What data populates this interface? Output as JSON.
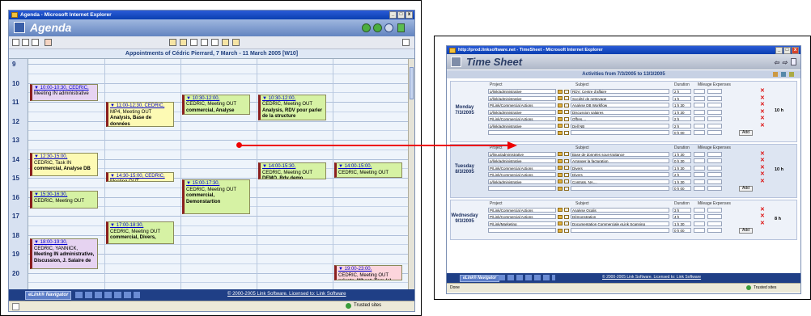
{
  "agenda": {
    "window_title": "Agenda - Microsoft Internet Explorer",
    "app_title": "Agenda",
    "calendar_header": "Appointments of Cédric Pierrard, 7 March - 11 March 2005 [W10]",
    "hours": [
      "9",
      "10",
      "11",
      "12",
      "13",
      "14",
      "15",
      "16",
      "17",
      "18",
      "19",
      "20"
    ],
    "events": [
      {
        "day": 0,
        "start": 10.05,
        "end": 10.95,
        "color": "p",
        "line1": "10:00-10:30, CEDRIC,",
        "line2": "Meeting IN administrative",
        "line3": ""
      },
      {
        "day": 1,
        "start": 11.0,
        "end": 12.3,
        "color": "y",
        "line1": "11:00-12:30, CEDRIC,",
        "line2": "MP4, Meeting OUT",
        "line3": "Analysis, Base de données"
      },
      {
        "day": 2,
        "start": 10.6,
        "end": 11.7,
        "color": "g",
        "line1": "10:30-12:00,",
        "line2": "CEDRIC, Meeting OUT",
        "line3": "commercial, Analyse"
      },
      {
        "day": 3,
        "start": 10.6,
        "end": 12.0,
        "color": "g",
        "line1": "10:30-12:00,",
        "line2": "CEDRIC, Meeting OUT",
        "line3": "Analysis, RDV pour parler de la structure"
      },
      {
        "day": 0,
        "start": 13.7,
        "end": 14.9,
        "color": "y",
        "line1": "12:30-15:00,",
        "line2": "CEDRIC, Task IN",
        "line3": "commercial, Analyse DB"
      },
      {
        "day": 1,
        "start": 14.7,
        "end": 15.2,
        "color": "y",
        "line1": "14:30-15:00, CEDRIC,",
        "line2": "Meeting OUT",
        "line3": ""
      },
      {
        "day": 2,
        "start": 15.1,
        "end": 16.9,
        "color": "g",
        "line1": "15:00-17:30,",
        "line2": "CEDRIC, Meeting OUT",
        "line3": "commercial, Demonstartion"
      },
      {
        "day": 3,
        "start": 14.2,
        "end": 15.1,
        "color": "g",
        "line1": "14:00-15:30,",
        "line2": "CEDRIC, Meeting OUT",
        "line3": "DEMO, Rdv demo"
      },
      {
        "day": 4,
        "start": 14.2,
        "end": 15.0,
        "color": "g",
        "line1": "14:00-15:00,",
        "line2": "CEDRIC, Meeting OUT",
        "line3": ""
      },
      {
        "day": 0,
        "start": 15.7,
        "end": 16.6,
        "color": "g",
        "line1": "15:30-16:30,",
        "line2": "CEDRIC, Meeting OUT",
        "line3": ""
      },
      {
        "day": 1,
        "start": 17.3,
        "end": 18.5,
        "color": "g",
        "line1": "17:00-18:30,",
        "line2": "CEDRIC, Meeting OUT",
        "line3": "commercial, Divers,"
      },
      {
        "day": 0,
        "start": 18.2,
        "end": 19.8,
        "color": "p",
        "line1": "18:00-19:30,",
        "line2": "CEDRIC, YANNICK,",
        "line3": "Meeting IN administrative, Discussion, J. Salaire de"
      },
      {
        "day": 4,
        "start": 19.6,
        "end": 20.4,
        "color": "r",
        "line1": "19:00-23:00,",
        "line2": "CEDRIC, Meeting OUT",
        "line3": "private, Wheat, Tom (c)"
      }
    ],
    "navigator_label": "eLink® Navigator",
    "copyright": "© 2000-2005 Link Software. Licensed to: Link Software",
    "status_zone": "Trusted sites"
  },
  "timesheet": {
    "window_title": "http://prod.linksoftware.net - TimeSheet - Microsoft Internet Explorer",
    "app_title": "Time Sheet",
    "activities_header": "Activities from 7/3/2005 to 13/3/2005",
    "col_project": "Project",
    "col_subject": "Subject",
    "col_duration": "Duration",
    "col_mileage": "Mileage Expenses",
    "add_label": "Add",
    "days": [
      {
        "name": "Monday",
        "date": "7/3/2005",
        "total": "10 h",
        "rows": [
          {
            "project": "p/link/administrative",
            "subject": "RDV: Centre d'affaire",
            "duration": "2 h"
          },
          {
            "project": "p/link/administrative",
            "subject": "Société de nettoyage",
            "duration": "1 h"
          },
          {
            "project": "P/Link/Commercial Actions",
            "subject": "Analyse DB Workflow",
            "duration": "1 h 30"
          },
          {
            "project": "p/link/administrative",
            "subject": "Discussion salaires",
            "duration": "1 h 30"
          },
          {
            "project": "P/Link/Commercial Actions",
            "subject": "Offres,...",
            "duration": "2 h"
          },
          {
            "project": "p/link/administrative",
            "subject": "Dell NB",
            "duration": "2 h"
          },
          {
            "project": "",
            "subject": "",
            "duration": "0 h 00"
          }
        ]
      },
      {
        "name": "Tuesday",
        "date": "8/3/2005",
        "total": "10 h",
        "rows": [
          {
            "project": "p/linux/administrative",
            "subject": "Base de données sous-traitance",
            "duration": "1 h 30"
          },
          {
            "project": "p/link/administrative",
            "subject": "Arranger la facturation",
            "duration": "0 h 30"
          },
          {
            "project": "P/Link/Commercial Actions",
            "subject": "Divers",
            "duration": "1 h 30"
          },
          {
            "project": "P/Link/Commercial Actions",
            "subject": "Divers",
            "duration": "2 h"
          },
          {
            "project": "p/link/administrative",
            "subject": "Contrats, NA,...",
            "duration": "1 h 30"
          },
          {
            "project": "",
            "subject": "",
            "duration": "0 h 00"
          }
        ]
      },
      {
        "name": "Wednesday",
        "date": "9/3/2005",
        "total": "8 h",
        "rows": [
          {
            "project": "P/Link/Commercial Actions",
            "subject": "Analyse Ocalis",
            "duration": "3 h"
          },
          {
            "project": "P/Link/Commercial Actions",
            "subject": "Démonstration",
            "duration": "4 h"
          },
          {
            "project": "P/Link/Marketing",
            "subject": "Documentation Commerciale eLink Scanning",
            "duration": "1 h 30"
          },
          {
            "project": "",
            "subject": "",
            "duration": "0 h 00"
          }
        ]
      }
    ],
    "navigator_label": "eLink® Navigator",
    "copyright": "© 2000-2005 Link Software. Licensed to: Link Software",
    "status_left": "Done",
    "status_zone": "Trusted sites"
  }
}
